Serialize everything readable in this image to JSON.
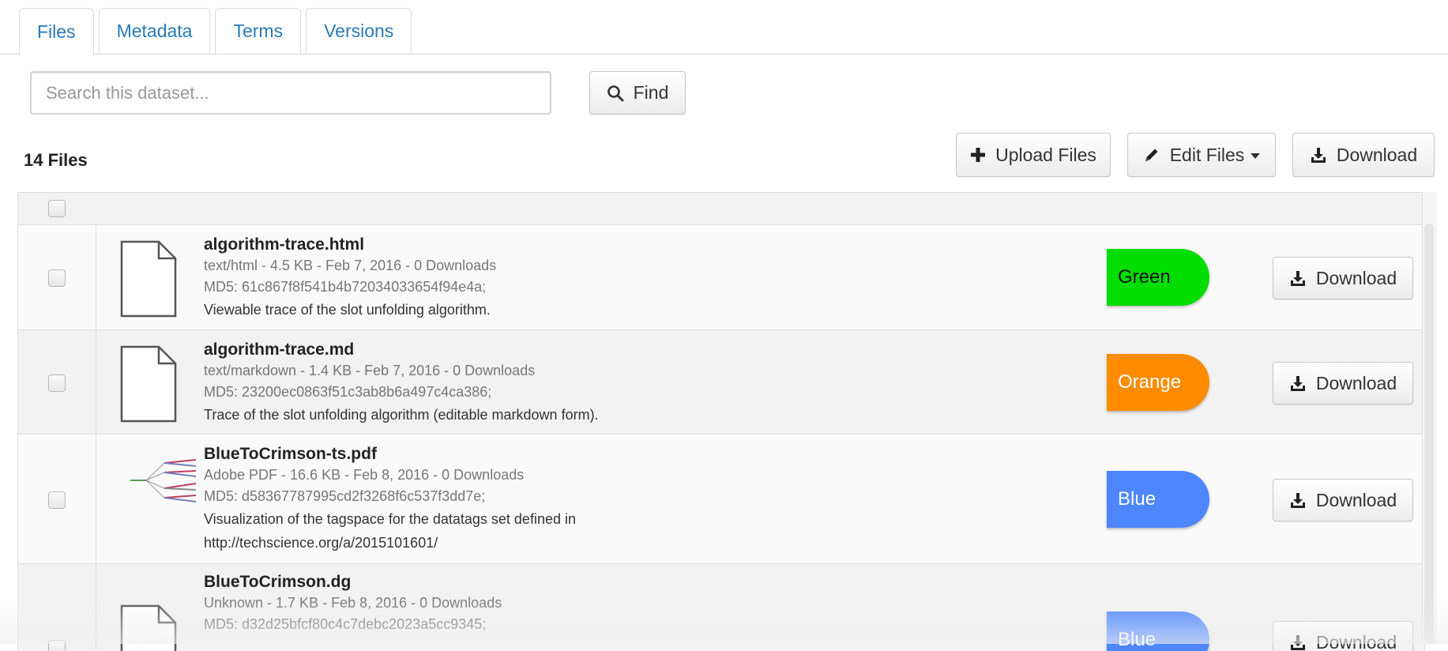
{
  "tabs": [
    {
      "label": "Files",
      "active": true
    },
    {
      "label": "Metadata",
      "active": false
    },
    {
      "label": "Terms",
      "active": false
    },
    {
      "label": "Versions",
      "active": false
    }
  ],
  "search": {
    "placeholder": "Search this dataset...",
    "value": "",
    "find_label": "Find"
  },
  "file_count": "14 Files",
  "toolbar": {
    "upload_label": "Upload Files",
    "edit_label": "Edit Files",
    "download_label": "Download"
  },
  "colors": {
    "link": "#2a7ab8",
    "green": "#00dd00",
    "orange": "#ff8c00",
    "blue": "#4d86ff"
  },
  "files": [
    {
      "name": "algorithm-trace.html",
      "meta": "text/html - 4.5 KB - Feb 7, 2016 - 0 Downloads",
      "md5": "MD5: 61c867f8f541b4b72034033654f94e4a;",
      "description": "Viewable trace of the slot unfolding algorithm.",
      "tag": "Green",
      "tag_color": "#00dd00",
      "tag_text_color": "#111111",
      "download_label": "Download",
      "icon": "document-icon"
    },
    {
      "name": "algorithm-trace.md",
      "meta": "text/markdown - 1.4 KB - Feb 7, 2016 - 0 Downloads",
      "md5": "MD5: 23200ec0863f51c3ab8b6a497c4ca386;",
      "description": "Trace of the slot unfolding algorithm (editable markdown form).",
      "tag": "Orange",
      "tag_color": "#ff8c00",
      "tag_text_color": "#ffffff",
      "download_label": "Download",
      "icon": "document-icon"
    },
    {
      "name": "BlueToCrimson-ts.pdf",
      "meta": "Adobe PDF - 16.6 KB - Feb 8, 2016 - 0 Downloads",
      "md5": "MD5: d58367787995cd2f3268f6c537f3dd7e;",
      "description": "Visualization of the tagspace for the datatags set defined in",
      "description2": "http://techscience.org/a/2015101601/",
      "tag": "Blue",
      "tag_color": "#4d86ff",
      "tag_text_color": "#ffffff",
      "download_label": "Download",
      "icon": "pdf-thumbnail-icon"
    },
    {
      "name": "BlueToCrimson.dg",
      "meta": "Unknown - 1.7 KB - Feb 8, 2016 - 0 Downloads",
      "md5": "MD5: d32d25bfcf80c4c7debc2023a5cc9345;",
      "tag": "Blue",
      "tag_color": "#4d86ff",
      "tag_text_color": "#ffffff",
      "download_label": "Download",
      "icon": "document-icon"
    }
  ]
}
